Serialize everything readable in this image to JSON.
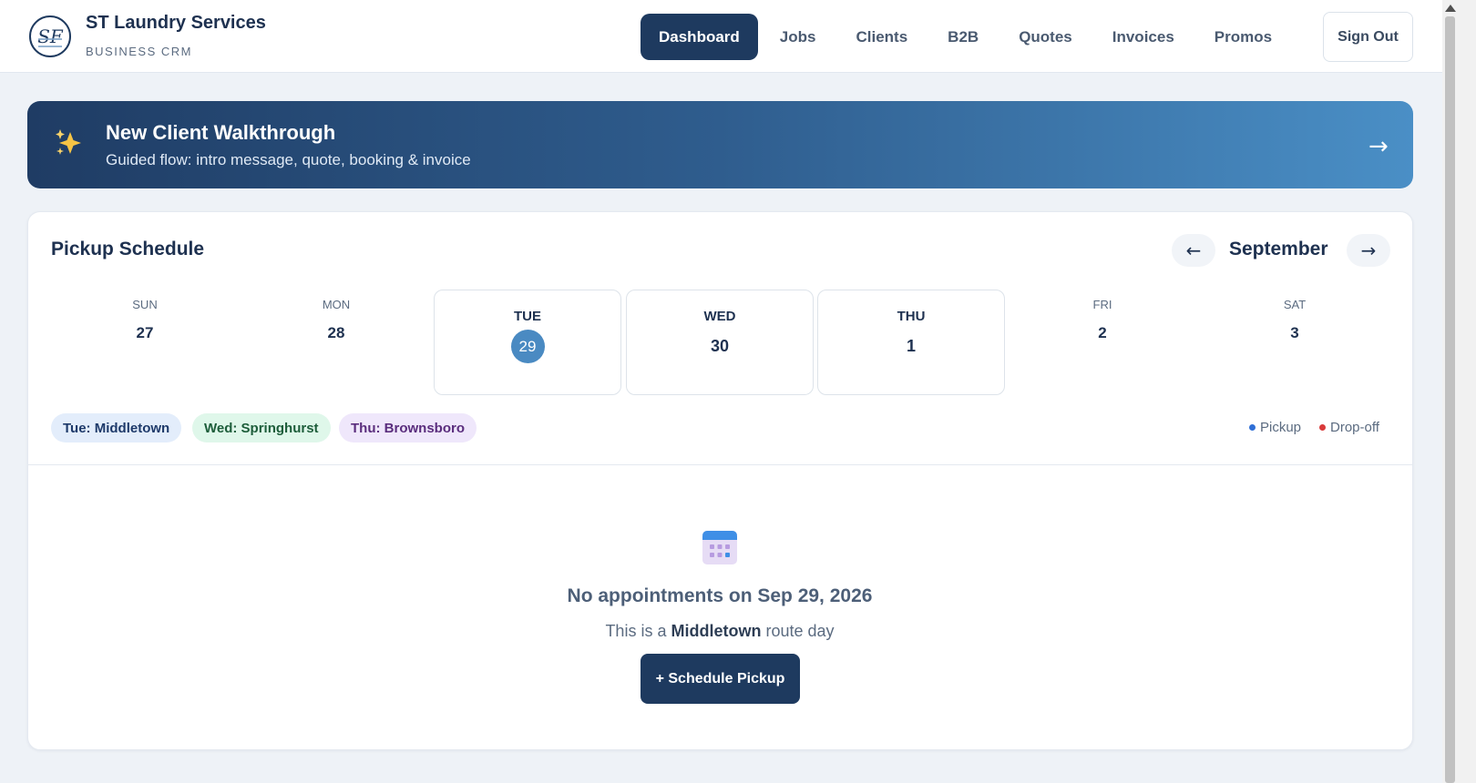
{
  "header": {
    "logo_text": "SF",
    "title": "ST Laundry Services",
    "subtitle": "BUSINESS CRM",
    "nav": [
      {
        "label": "Dashboard",
        "active": true
      },
      {
        "label": "Jobs",
        "active": false
      },
      {
        "label": "Clients",
        "active": false
      },
      {
        "label": "B2B",
        "active": false
      },
      {
        "label": "Quotes",
        "active": false
      },
      {
        "label": "Invoices",
        "active": false
      },
      {
        "label": "Promos",
        "active": false
      }
    ],
    "sign_out": "Sign Out"
  },
  "banner": {
    "icon": "sparkles-icon",
    "title": "New Client Walkthrough",
    "subtitle": "Guided flow: intro message, quote, booking & invoice",
    "arrow": "→"
  },
  "schedule": {
    "title": "Pickup Schedule",
    "prev": "←",
    "next": "→",
    "month": "September",
    "days": [
      {
        "dow": "SUN",
        "num": "27",
        "boxed": false,
        "today": false
      },
      {
        "dow": "MON",
        "num": "28",
        "boxed": false,
        "today": false
      },
      {
        "dow": "TUE",
        "num": "29",
        "boxed": true,
        "today": true
      },
      {
        "dow": "WED",
        "num": "30",
        "boxed": true,
        "today": false
      },
      {
        "dow": "THU",
        "num": "1",
        "boxed": true,
        "today": false
      },
      {
        "dow": "FRI",
        "num": "2",
        "boxed": false,
        "today": false
      },
      {
        "dow": "SAT",
        "num": "3",
        "boxed": false,
        "today": false
      }
    ],
    "routes": [
      {
        "label": "Tue: Middletown"
      },
      {
        "label": "Wed: Springhurst"
      },
      {
        "label": "Thu: Brownsboro"
      }
    ],
    "legend": [
      {
        "label": "Pickup",
        "color": "#2f6fd6"
      },
      {
        "label": "Drop-off",
        "color": "#d93a3a"
      }
    ],
    "empty": {
      "icon": "calendar-icon",
      "title": "No appointments on Sep 29, 2026",
      "sub_prefix": "This is a",
      "sub_route": "Middletown",
      "sub_suffix": "route day",
      "button": "+ Schedule Pickup"
    }
  },
  "colors": {
    "primary": "#1e3a5f",
    "accent": "#4a8ac2",
    "background": "#eef2f7"
  }
}
